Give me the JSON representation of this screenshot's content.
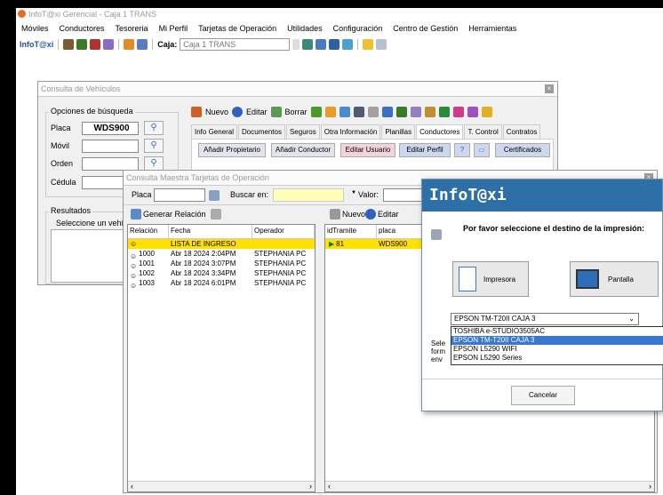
{
  "app": {
    "title": "InfoT@xi Gerencial - Caja 1 TRANS"
  },
  "menu": [
    "Móviles",
    "Conductores",
    "Tesoreria",
    "Mi Perfil",
    "Tarjetas de Operación",
    "Utilidades",
    "Configuración",
    "Centro de Gestión",
    "Herramientas"
  ],
  "toolbar": {
    "logo": "InfoT@xi",
    "caja_label": "Caja:",
    "caja_value": "Caja 1 TRANS"
  },
  "vehiculos": {
    "title": "Consulta de Vehículos",
    "opciones_label": "Opciones de búsqueda",
    "placa_label": "Placa",
    "placa_value": "WDS900",
    "movil_label": "Móvil",
    "orden_label": "Orden",
    "cedula_label": "Cédula",
    "resultados_label": "Resultados",
    "seleccione": "Seleccione un vehí",
    "actions": {
      "nuevo": "Nuevo",
      "editar": "Editar",
      "borrar": "Borrar"
    },
    "tabs": [
      "Info General",
      "Documentos",
      "Seguros",
      "Otra Información",
      "Planillas",
      "Conductores",
      "T. Control",
      "Contratos"
    ],
    "active_tab": "Conductores",
    "buttons": {
      "propietario": "Añadir Propietario",
      "conductor": "Añadir Conductor",
      "usuario": "Editar Usuario",
      "perfil": "Editar Perfil",
      "certificados": "Certificados"
    }
  },
  "maestra": {
    "title": "Consulta Maestra Tarjetas de Operación",
    "placa_label": "Placa",
    "buscar_label": "Buscar en:",
    "valor_label": "Valor:",
    "generar": "Generar Relación",
    "nuevo": "Nuevo",
    "editar": "Editar",
    "columns": [
      "Relación",
      "Fecha",
      "Operador"
    ],
    "rows": [
      {
        "rel": "",
        "fecha": "LISTA DE INGRESO",
        "op": ""
      },
      {
        "rel": "1000",
        "fecha": "Abr 18 2024  2:04PM",
        "op": "STEPHANIA PC"
      },
      {
        "rel": "1001",
        "fecha": "Abr 18 2024  3:07PM",
        "op": "STEPHANIA PC"
      },
      {
        "rel": "1002",
        "fecha": "Abr 18 2024  3:34PM",
        "op": "STEPHANIA PC"
      },
      {
        "rel": "1003",
        "fecha": "Abr 18 2024  6:01PM",
        "op": "STEPHANIA PC"
      }
    ],
    "right_columns": [
      "idTramite",
      "placa"
    ],
    "right_rows": [
      {
        "id": "81",
        "placa": "WDS900"
      }
    ]
  },
  "dialog": {
    "title": "InfoT@xi",
    "prompt": "Por favor seleccione el destino de la impresión:",
    "impresora": "Impresora",
    "pantalla": "Pantalla",
    "selected_printer": "EPSON TM-T20II CAJA 3",
    "printers": [
      "TOSHIBA e-STUDIO3505AC",
      "EPSON TM-T20II CAJA 3",
      "EPSON L5290 WIFI",
      "EPSON L5290 Series"
    ],
    "hint_lines": [
      "Sele",
      "form",
      "env"
    ],
    "cancel": "Cancelar"
  }
}
